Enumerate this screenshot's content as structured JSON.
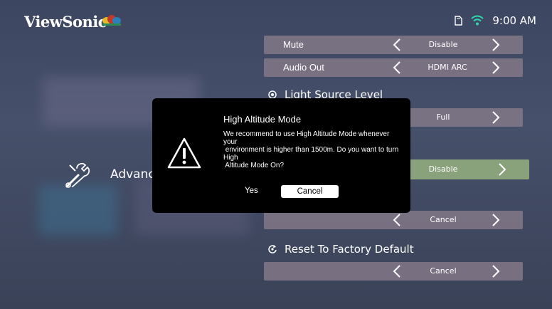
{
  "brand": {
    "name": "ViewSonic",
    "birds_icon": "viewsonic-birds-icon"
  },
  "status": {
    "time": "9:00 AM",
    "storage_icon": "sd-card-icon",
    "wifi_icon": "wifi-icon"
  },
  "left_menu": {
    "label": "Advanced",
    "icon": "tools-icon"
  },
  "settings": {
    "rows": [
      {
        "label": "Mute",
        "value": "Disable"
      },
      {
        "label": "Audio Out",
        "value": "HDMI ARC"
      },
      {
        "label": "",
        "value": "Full"
      },
      {
        "label": "",
        "value": "Disable"
      },
      {
        "label": "",
        "value": "Cancel"
      },
      {
        "label": "",
        "value": "Cancel"
      }
    ],
    "sections": [
      {
        "label": "Light Source Level",
        "icon": "brightness-icon"
      },
      {
        "label": "Reset To Factory Default",
        "icon": "reset-icon"
      }
    ]
  },
  "dialog": {
    "title": "High Altitude Mode",
    "message_lines": [
      "We recommend to use High Altitude Mode whenever",
      "your",
      " environment is higher than 1500m. Do you want to turn",
      "High",
      " Altitude Mode On?"
    ],
    "yes_label": "Yes",
    "cancel_label": "Cancel",
    "icon": "warning-icon"
  },
  "colors": {
    "accent_row": "#8aa27c",
    "row_bg": "#827887",
    "dialog_bg": "#000000"
  }
}
